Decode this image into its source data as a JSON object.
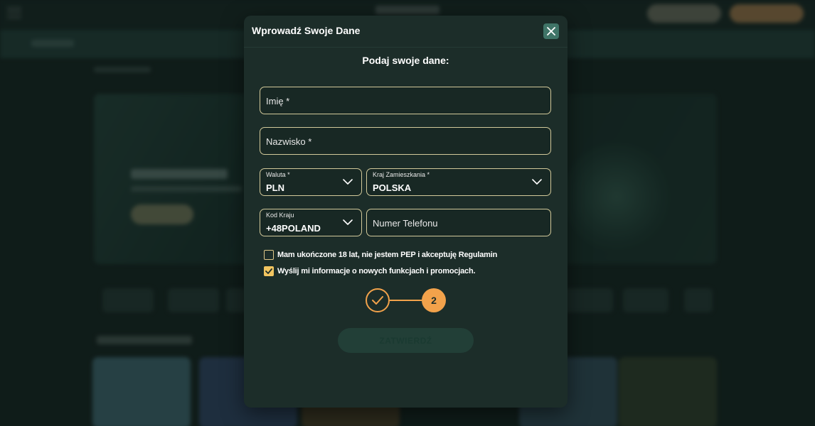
{
  "modal": {
    "title": "Wprowadź Swoje Dane",
    "subtitle": "Podaj swoje dane:",
    "close_icon": "close-icon"
  },
  "form": {
    "first_name_placeholder": "Imię *",
    "last_name_placeholder": "Nazwisko *",
    "currency": {
      "label": "Waluta *",
      "value": "PLN"
    },
    "country": {
      "label": "Kraj Zamieszkania *",
      "value": "POLSKA"
    },
    "country_code": {
      "label": "Kod Kraju",
      "value": "+48POLAND"
    },
    "phone_placeholder": "Numer Telefonu"
  },
  "consents": [
    {
      "label": "Mam ukończone 18 lat, nie jestem PEP i akceptuję Regulamin",
      "checked": false
    },
    {
      "label": "Wyślij mi informacje o nowych funkcjach i promocjach.",
      "checked": true
    }
  ],
  "stepper": {
    "step1_icon": "check-icon",
    "step2_label": "2"
  },
  "submit_label": "ZATWIERDŹ",
  "colors": {
    "accent": "#f2a24b",
    "field_border": "#d2c99a",
    "modal_bg": "#1c2d29",
    "close_bg": "#3f7467"
  }
}
